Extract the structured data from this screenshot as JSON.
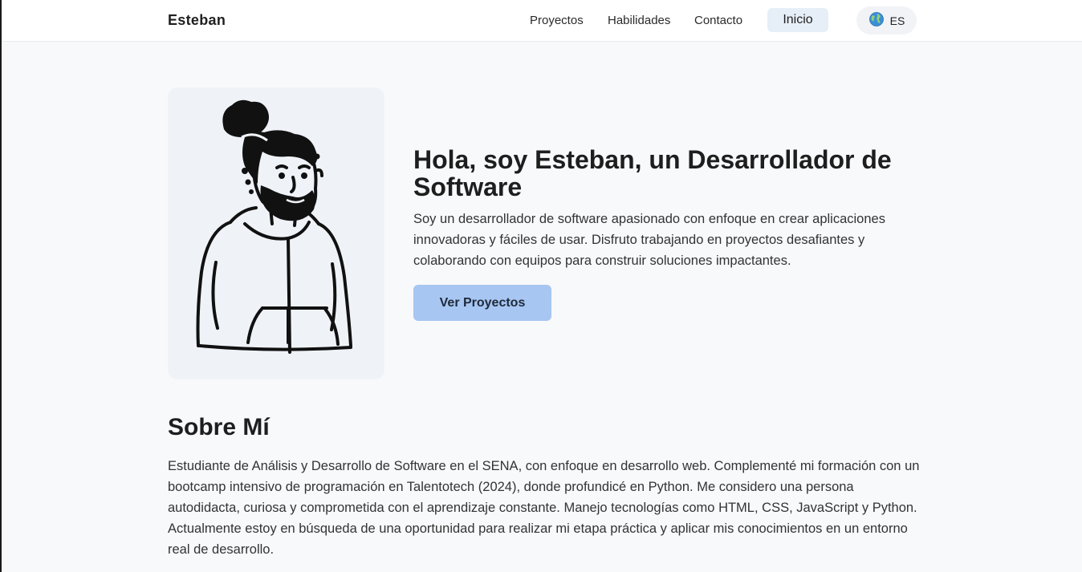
{
  "header": {
    "brand": "Esteban",
    "nav": [
      "Proyectos",
      "Habilidades",
      "Contacto"
    ],
    "active": "Inicio",
    "language": "ES",
    "language_icon": "globe-icon"
  },
  "hero": {
    "avatar_icon": "developer-illustration",
    "title": "Hola, soy Esteban, un Desarrollador de Software",
    "description": "Soy un desarrollador de software apasionado con enfoque en crear aplicaciones innovadoras y fáciles de usar. Disfruto trabajando en proyectos desafiantes y colaborando con equipos para construir soluciones impactantes.",
    "cta": "Ver Proyectos"
  },
  "about": {
    "title": "Sobre Mí",
    "text": "Estudiante de Análisis y Desarrollo de Software en el SENA, con enfoque en desarrollo web. Complementé mi formación con un bootcamp intensivo de programación en Talentotech (2024), donde profundicé en Python. Me considero una persona autodidacta, curiosa y comprometida con el aprendizaje constante. Manejo tecnologías como HTML, CSS, JavaScript y Python. Actualmente estoy en búsqueda de una oportunidad para realizar mi etapa práctica y aplicar mis conocimientos en un entorno real de desarrollo."
  },
  "colors": {
    "accent": "#a7c6f2",
    "nav_active_bg": "#e6eef8",
    "card_bg": "#eff3f8"
  }
}
